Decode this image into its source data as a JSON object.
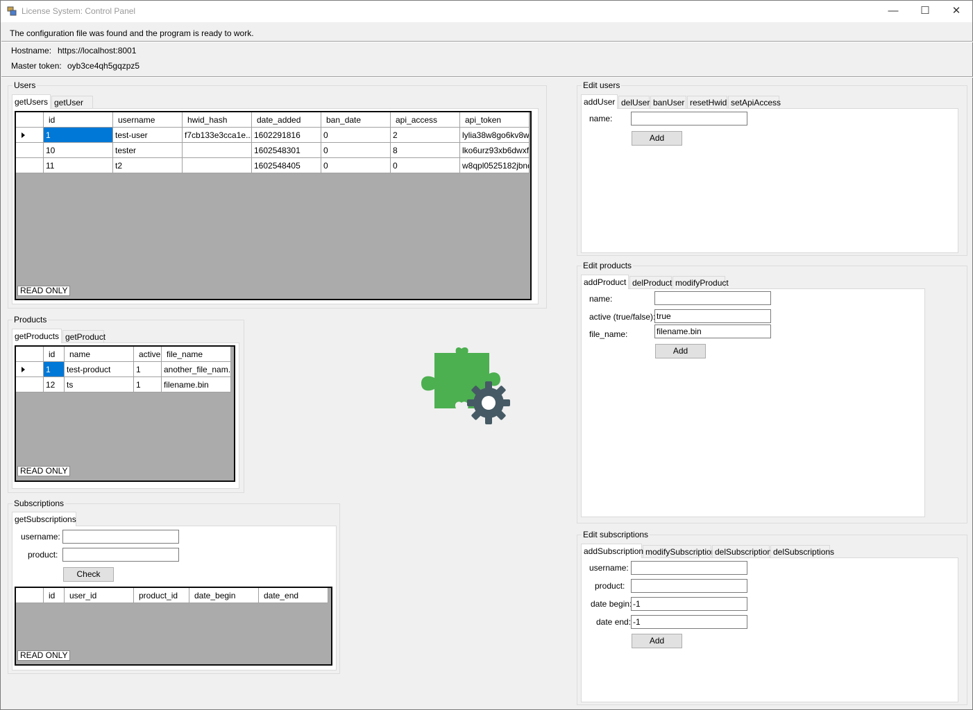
{
  "window": {
    "title": "License System: Control Panel",
    "minimize_glyph": "—",
    "maximize_glyph": "☐",
    "close_glyph": "✕"
  },
  "status": {
    "message": "The configuration file was found and the program is ready to work."
  },
  "server": {
    "hostname_label": "Hostname:",
    "hostname_value": "https://localhost:8001",
    "token_label": "Master token:",
    "token_value": "oyb3ce4qh5gqzpz5"
  },
  "users": {
    "group_title": "Users",
    "tabs": [
      "getUsers",
      "getUser"
    ],
    "columns": [
      "id",
      "username",
      "hwid_hash",
      "date_added",
      "ban_date",
      "api_access",
      "api_token"
    ],
    "rows": [
      [
        "1",
        "test-user",
        "f7cb133e3cca1e...",
        "1602291816",
        "0",
        "2",
        "lylia38w8go6kv8w"
      ],
      [
        "10",
        "tester",
        "",
        "1602548301",
        "0",
        "8",
        "lko6urz93xb6dwxf"
      ],
      [
        "11",
        "t2",
        "",
        "1602548405",
        "0",
        "0",
        "w8qpl0525182jbnq"
      ]
    ],
    "readonly": "READ ONLY"
  },
  "products": {
    "group_title": "Products",
    "tabs": [
      "getProducts",
      "getProduct"
    ],
    "columns": [
      "id",
      "name",
      "active",
      "file_name"
    ],
    "rows": [
      [
        "1",
        "test-product",
        "1",
        "another_file_nam..."
      ],
      [
        "12",
        "ts",
        "1",
        "filename.bin"
      ]
    ],
    "readonly": "READ ONLY"
  },
  "subscriptions": {
    "group_title": "Subscriptions",
    "tabs": [
      "getSubscriptions"
    ],
    "username_label": "username:",
    "product_label": "product:",
    "check_label": "Check",
    "columns": [
      "id",
      "user_id",
      "product_id",
      "date_begin",
      "date_end"
    ],
    "readonly": "READ ONLY"
  },
  "edit_users": {
    "group_title": "Edit users",
    "tabs": [
      "addUser",
      "delUser",
      "banUser",
      "resetHwid",
      "setApiAccess"
    ],
    "name_label": "name:",
    "name_value": "",
    "add_label": "Add"
  },
  "edit_products": {
    "group_title": "Edit products",
    "tabs": [
      "addProduct",
      "delProduct",
      "modifyProduct"
    ],
    "name_label": "name:",
    "name_value": "",
    "active_label": "active (true/false):",
    "active_value": "true",
    "file_label": "file_name:",
    "file_value": "filename.bin",
    "add_label": "Add"
  },
  "edit_subscriptions": {
    "group_title": "Edit subscriptions",
    "tabs": [
      "addSubscription",
      "modifySubscription",
      "delSubscription",
      "delSubscriptions"
    ],
    "username_label": "username:",
    "username_value": "",
    "product_label": "product:",
    "product_value": "",
    "begin_label": "date begin:",
    "begin_value": "-1",
    "end_label": "date end:",
    "end_value": "-1",
    "add_label": "Add"
  },
  "logo": {
    "icon": "puzzle-gear-icon",
    "puzzle_color": "#4caf50",
    "gear_color": "#455a64"
  }
}
